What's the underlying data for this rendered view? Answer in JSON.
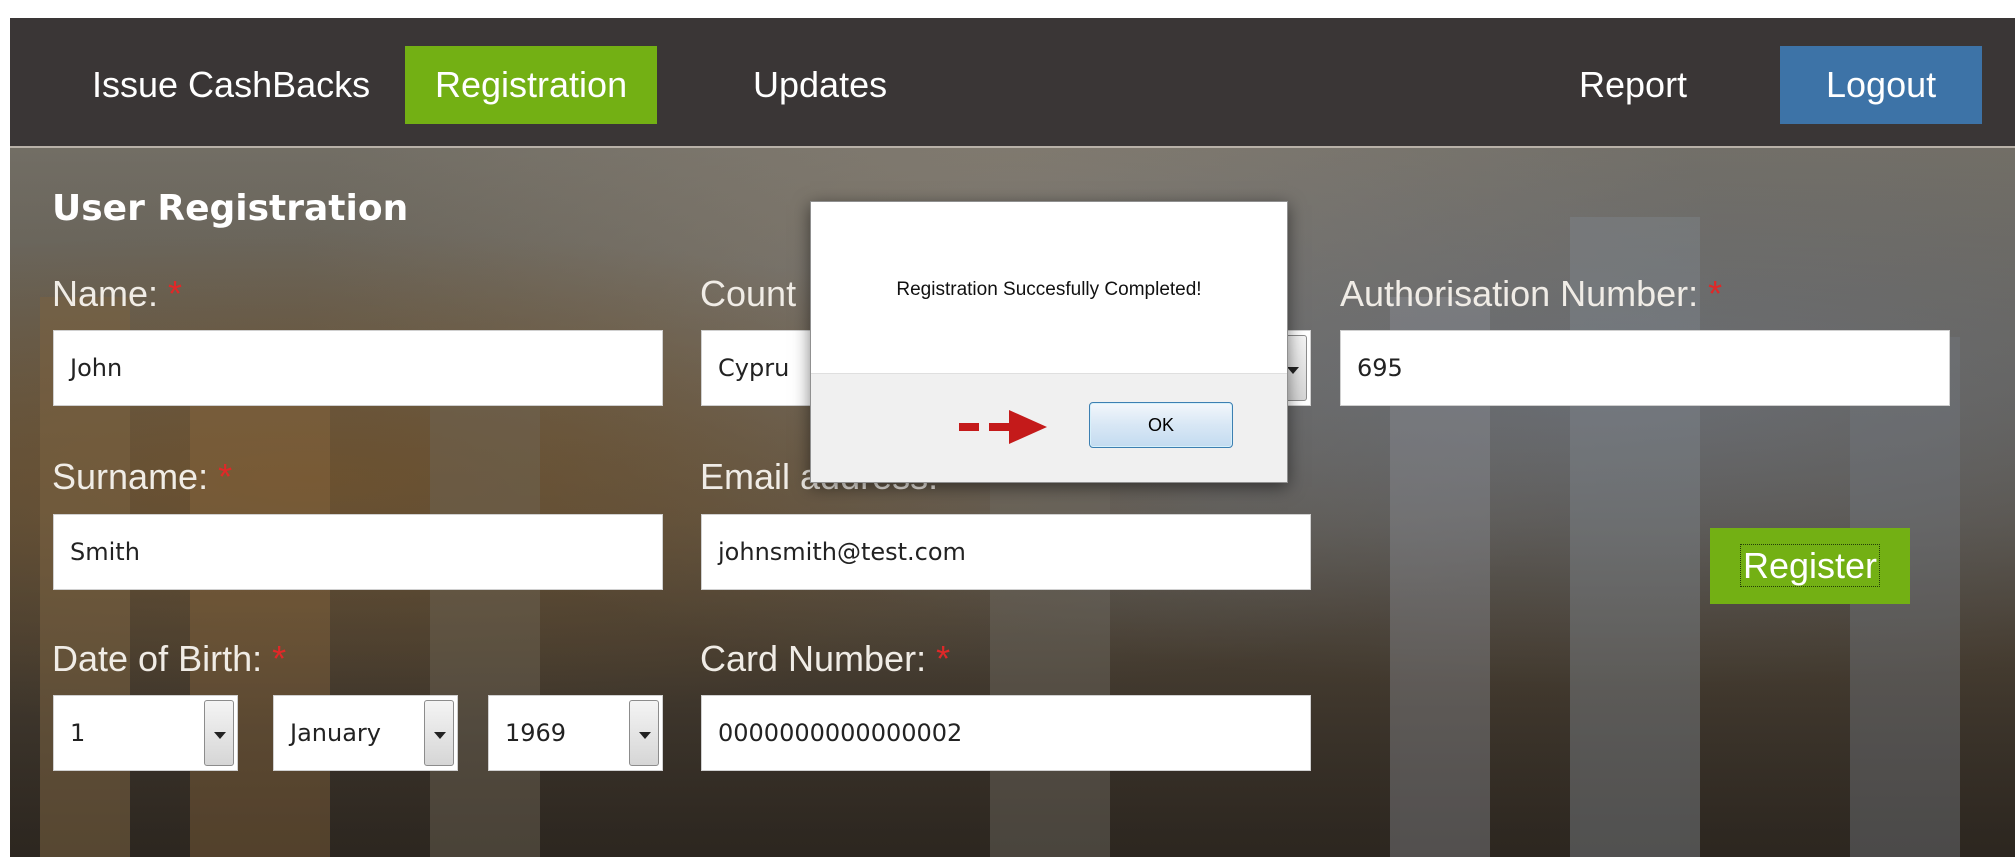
{
  "nav": {
    "items": [
      {
        "label": "Issue CashBacks",
        "active": false
      },
      {
        "label": "Registration",
        "active": true
      },
      {
        "label": "Updates",
        "active": false
      }
    ],
    "report_label": "Report",
    "logout_label": "Logout"
  },
  "page": {
    "title": "User Registration"
  },
  "form": {
    "name": {
      "label": "Name:",
      "value": "John",
      "required_mark": "*"
    },
    "surname": {
      "label": "Surname:",
      "value": "Smith",
      "required_mark": "*"
    },
    "date_of_birth": {
      "label": "Date of Birth:",
      "required_mark": "*",
      "day": "1",
      "month": "January",
      "year": "1969"
    },
    "country": {
      "label": "Count",
      "value": "Cypru"
    },
    "email": {
      "label": "Email address:",
      "value": "johnsmith@test.com",
      "required_mark": "*"
    },
    "card_number": {
      "label": "Card Number:",
      "value": "0000000000000002",
      "required_mark": "*"
    },
    "authorisation_number": {
      "label": "Authorisation Number:",
      "value": "695",
      "required_mark": "*"
    },
    "register_label": "Register"
  },
  "dialog": {
    "message": "Registration Succesfully Completed!",
    "ok_label": "OK"
  },
  "colors": {
    "nav_background": "#3a3636",
    "active_nav": "#73b014",
    "logout": "#3d73a7",
    "register_button": "#73b014",
    "required_mark": "#e02828",
    "annotation_arrow": "#c41a1a"
  },
  "icons": {
    "select_arrow": "chevron-down-icon",
    "annotation": "arrow-right-icon"
  }
}
